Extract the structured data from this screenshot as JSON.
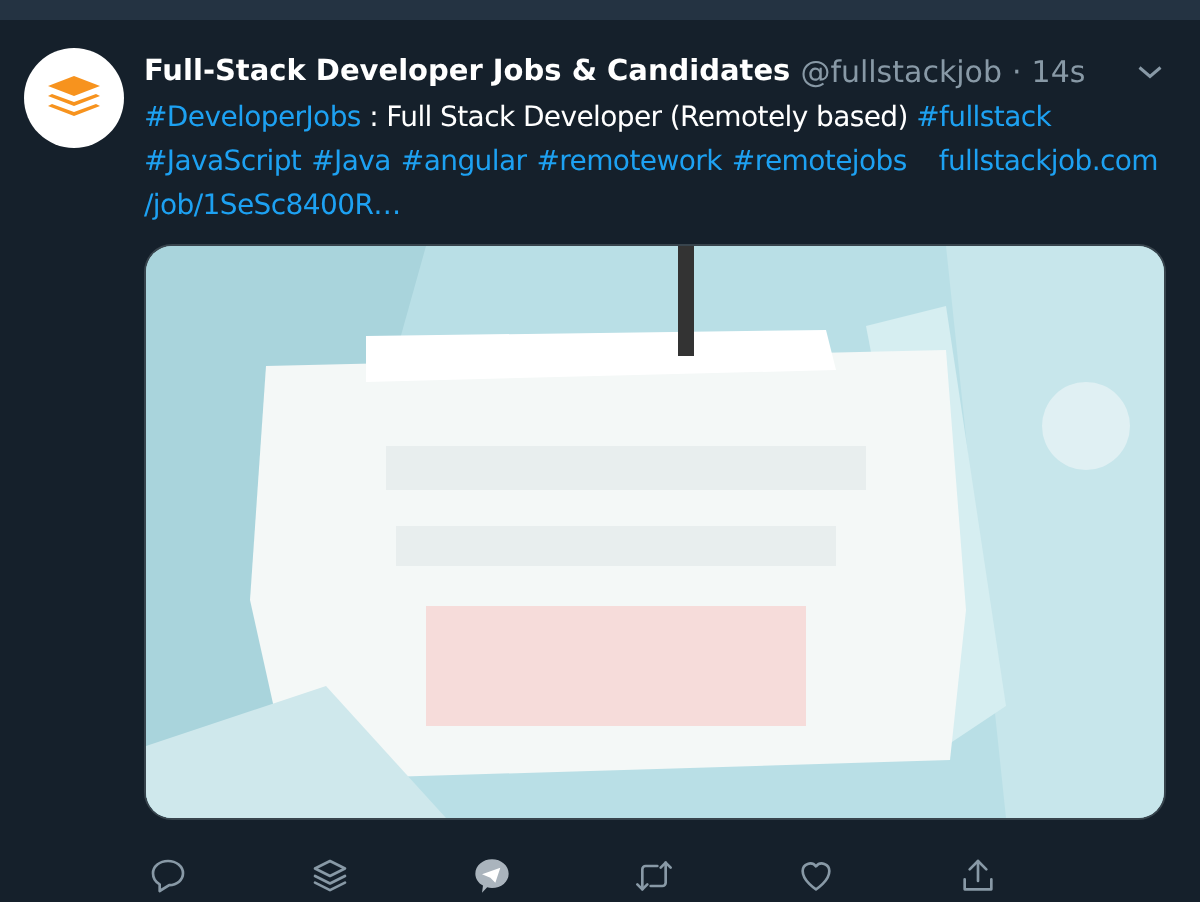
{
  "tweet": {
    "author": "Full-Stack Developer Jobs & Candidates",
    "handle": "@fullstackjob",
    "separator": "·",
    "time": "14s",
    "text_lines": [
      [
        {
          "kind": "hashtag",
          "text": "#DeveloperJobs"
        },
        {
          "kind": "text",
          "text": " : Full Stack Developer (Remotely based) "
        },
        {
          "kind": "hashtag",
          "text": "#fullstack"
        }
      ],
      [
        {
          "kind": "hashtag",
          "text": "#JavaScript"
        },
        {
          "kind": "hashtag",
          "text": "#Java"
        },
        {
          "kind": "hashtag",
          "text": "#angular"
        },
        {
          "kind": "hashtag",
          "text": "#remotework"
        },
        {
          "kind": "hashtag",
          "text": "#remotejobs"
        },
        {
          "kind": "url",
          "text": "fullstackjob.com"
        }
      ],
      [
        {
          "kind": "url",
          "text": "/job/1SeSc8400R…"
        }
      ]
    ],
    "actions": [
      {
        "kind": "reply"
      },
      {
        "kind": "layers"
      },
      {
        "kind": "telegram"
      },
      {
        "kind": "retweet"
      },
      {
        "kind": "like"
      },
      {
        "kind": "share"
      }
    ]
  }
}
